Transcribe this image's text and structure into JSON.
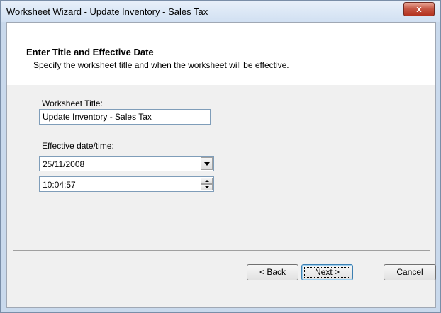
{
  "window": {
    "title": "Worksheet Wizard - Update Inventory - Sales Tax",
    "close_label": "x"
  },
  "header": {
    "title": "Enter Title and Effective Date",
    "subtitle": "Specify the worksheet title and when the worksheet will be effective."
  },
  "form": {
    "title_label": "Worksheet Title:",
    "title_value": "Update Inventory - Sales Tax",
    "date_label": "Effective date/time:",
    "date_value": "25/11/2008",
    "time_value": "10:04:57"
  },
  "buttons": {
    "back": "< Back",
    "next": "Next >",
    "cancel": "Cancel"
  }
}
